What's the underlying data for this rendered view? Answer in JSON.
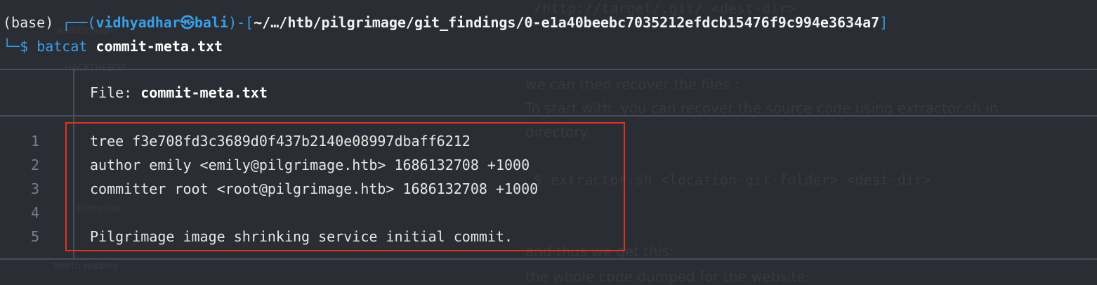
{
  "prompt": {
    "env": "(base)",
    "corner_top": "┌──(",
    "user": "vidhyadhar",
    "at_symbol": "㉿",
    "host": "bali",
    "sep": ")-[",
    "path": "~/…/htb/pilgrimage/git_findings/0-e1a40beebc7035212efdcb15476f9c994e3634a7",
    "close": "]",
    "corner_bottom": "└─",
    "dollar": "$",
    "command": "batcat",
    "argument": "commit-meta.txt"
  },
  "file": {
    "label": "File:",
    "name": "commit-meta.txt"
  },
  "lines": [
    {
      "no": "1",
      "text": "tree f3e708fd3c3689d0f437b2140e08997dbaff6212"
    },
    {
      "no": "2",
      "text": "author emily <emily@pilgrimage.htb> 1686132708 +1000"
    },
    {
      "no": "3",
      "text": "committer root <root@pilgrimage.htb> 1686132708 +1000"
    },
    {
      "no": "4",
      "text": ""
    },
    {
      "no": "5",
      "text": "Pilgrimage image shrinking service initial commit."
    }
  ],
  "colors": {
    "background": "#2a2d33",
    "prompt_blue": "#3b9ee8",
    "highlight_red": "#e0321f"
  }
}
